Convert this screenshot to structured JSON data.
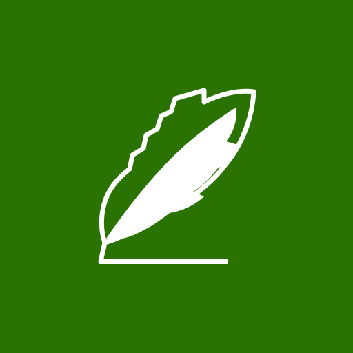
{
  "app_icon": {
    "icon": "feather-quill-icon",
    "colors": {
      "background": "#2A7303",
      "glyph": "#FFFFFF"
    }
  }
}
